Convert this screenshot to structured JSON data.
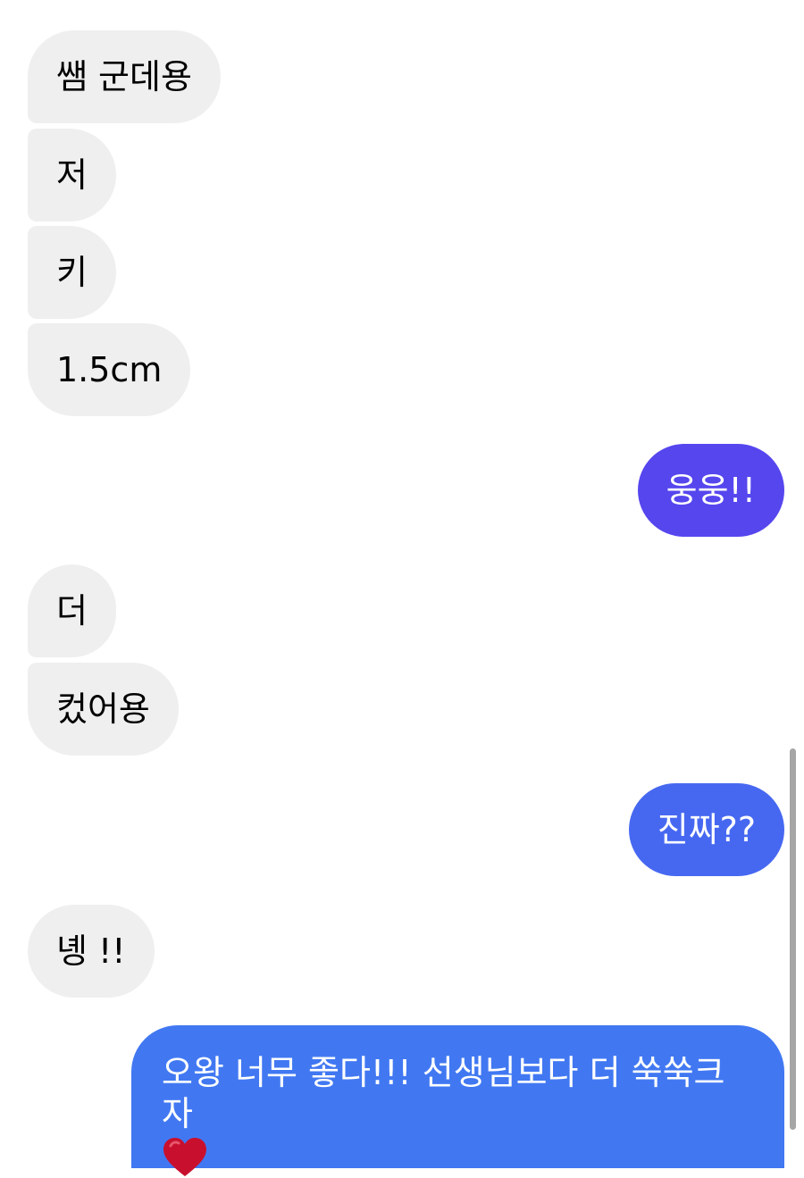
{
  "colors": {
    "incoming_bg": "#efefef",
    "outgoing_gradient_top": "#5b45f0",
    "outgoing_gradient_bottom": "#3e7af0"
  },
  "messages": [
    {
      "direction": "incoming",
      "text": "쌤 군데용"
    },
    {
      "direction": "incoming",
      "text": "저"
    },
    {
      "direction": "incoming",
      "text": "키"
    },
    {
      "direction": "incoming",
      "text": "1.5cm"
    },
    {
      "direction": "outgoing",
      "text": "웅웅!!"
    },
    {
      "direction": "incoming",
      "text": "더"
    },
    {
      "direction": "incoming",
      "text": "컸어용"
    },
    {
      "direction": "outgoing",
      "text": "진짜??"
    },
    {
      "direction": "incoming",
      "text": "녱 !!"
    },
    {
      "direction": "outgoing",
      "text": "오왕 너무 좋다!!! 선생님보다 더 쑥쑥크자",
      "emoji": "heart-emoji"
    }
  ]
}
